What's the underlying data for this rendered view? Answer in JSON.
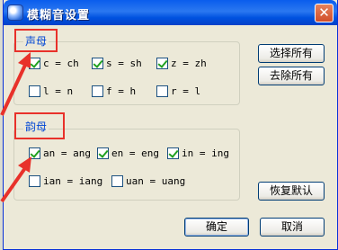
{
  "window": {
    "title": "模糊音设置",
    "close_glyph": "✕"
  },
  "shengmu": {
    "title": "声母",
    "items": [
      {
        "label": "c = ch",
        "checked": true
      },
      {
        "label": "s = sh",
        "checked": true
      },
      {
        "label": "z = zh",
        "checked": true
      },
      {
        "label": "l = n",
        "checked": false
      },
      {
        "label": "f = h",
        "checked": false
      },
      {
        "label": "r = l",
        "checked": false
      }
    ]
  },
  "yunmu": {
    "title": "韵母",
    "items": [
      {
        "label": "an = ang",
        "checked": true
      },
      {
        "label": "en = eng",
        "checked": true
      },
      {
        "label": "in = ing",
        "checked": true
      },
      {
        "label": "ian = iang",
        "checked": false
      },
      {
        "label": "uan = uang",
        "checked": false
      }
    ]
  },
  "buttons": {
    "select_all": "选择所有",
    "clear_all": "去除所有",
    "restore_default": "恢复默认",
    "ok": "确定",
    "cancel": "取消"
  },
  "colors": {
    "highlight": "#e8312a",
    "group_title": "#0046d5"
  }
}
